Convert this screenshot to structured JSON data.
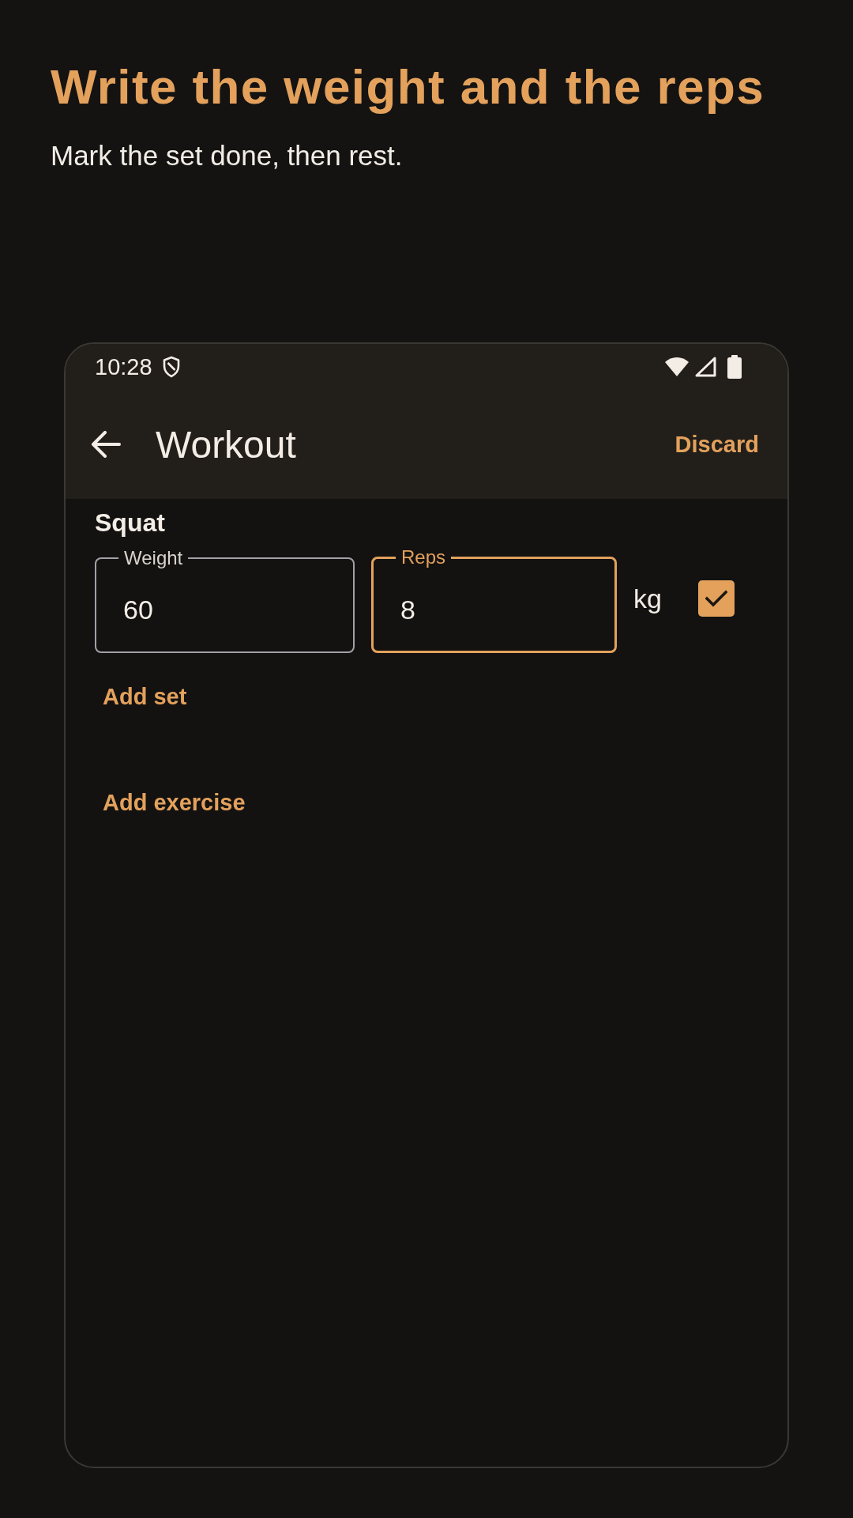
{
  "banner": {
    "title": "Write the weight and the reps",
    "subtitle": "Mark the set done, then rest."
  },
  "status_bar": {
    "time": "10:28"
  },
  "app_bar": {
    "title": "Workout",
    "action": "Discard"
  },
  "exercises": [
    {
      "name": "Squat",
      "sets": [
        {
          "fields": [
            {
              "label": "Weight",
              "value": "60",
              "focused": false
            },
            {
              "label": "Reps",
              "value": "8",
              "focused": true
            }
          ],
          "unit": "kg",
          "done": true
        }
      ],
      "add_set": "Add set"
    }
  ],
  "add_exercise": "Add exercise"
}
